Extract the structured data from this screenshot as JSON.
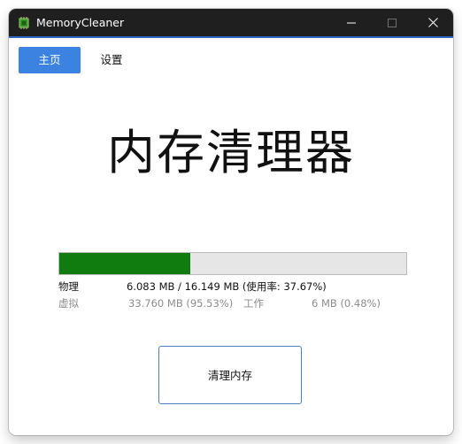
{
  "window": {
    "title": "MemoryCleaner"
  },
  "nav": {
    "home_label": "主页",
    "settings_label": "设置"
  },
  "main": {
    "heading": "内存清理器",
    "physical": {
      "label": "物理",
      "value": "6.083 MB / 16.149 MB (使用率: 37.67%)",
      "usage_fraction": 0.3767
    },
    "virtual": {
      "label": "虚拟",
      "value": "33.760 MB (95.53%)"
    },
    "working": {
      "label": "工作",
      "value": "6 MB (0.48%)"
    },
    "clean_button_label": "清理内存"
  },
  "colors": {
    "titlebar": "#1f1f1f",
    "accent": "#3c82e0",
    "progress_fill": "#107c10",
    "progress_track": "#e6e6e6"
  },
  "icons": {
    "app": "memory-chip-icon",
    "minimize": "minimize-icon",
    "maximize": "maximize-icon",
    "close": "close-icon"
  }
}
